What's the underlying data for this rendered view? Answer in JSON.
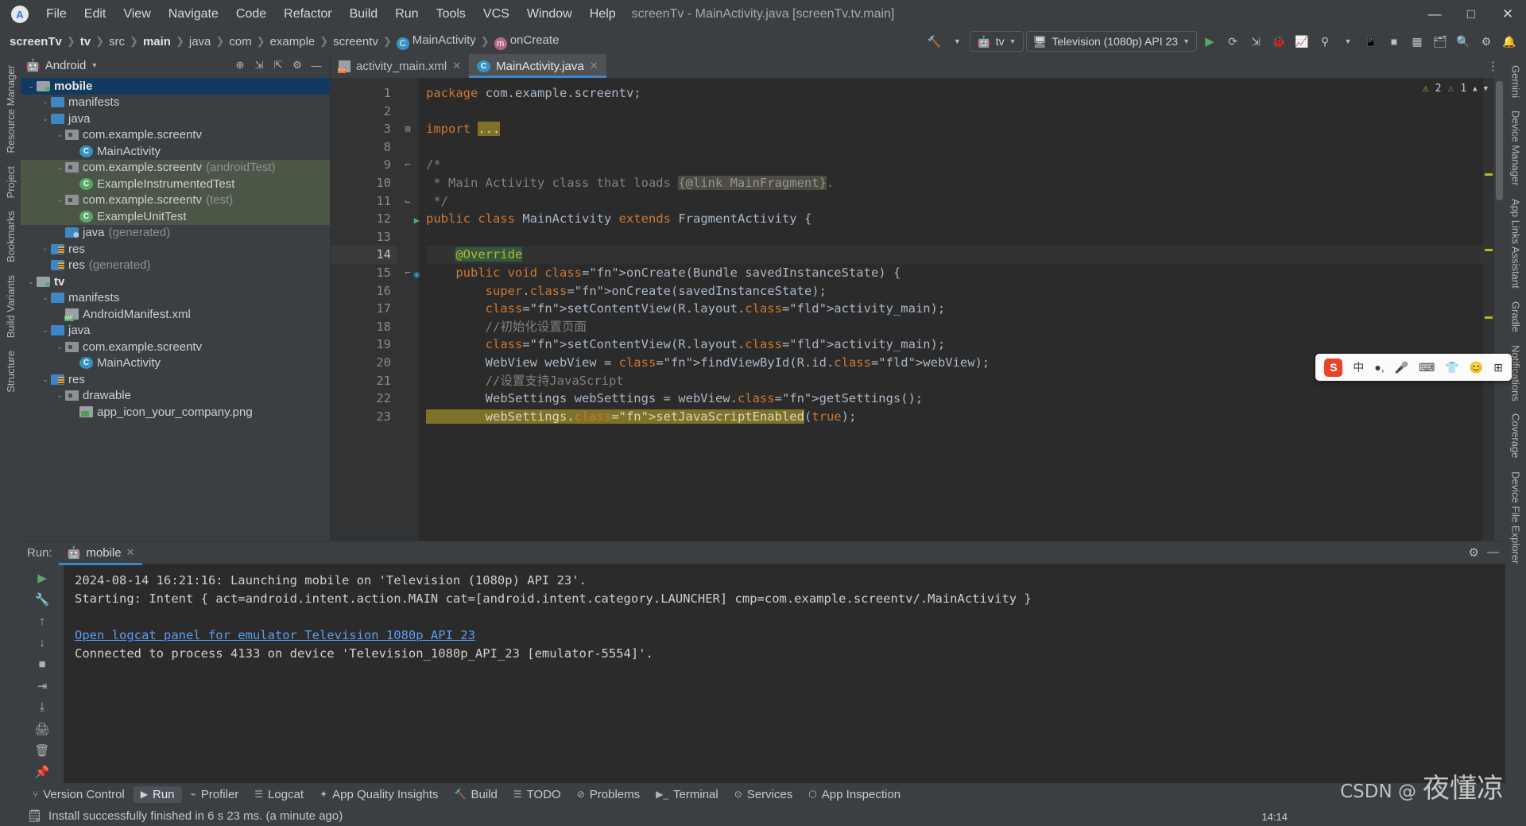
{
  "window": {
    "title": "screenTv - MainActivity.java [screenTv.tv.main]",
    "minimize": "—",
    "maximize": "□",
    "close": "✕"
  },
  "menu": [
    "File",
    "Edit",
    "View",
    "Navigate",
    "Code",
    "Refactor",
    "Build",
    "Run",
    "Tools",
    "VCS",
    "Window",
    "Help"
  ],
  "breadcrumbs": [
    {
      "label": "screenTv",
      "bold": true
    },
    {
      "label": "tv",
      "bold": true
    },
    {
      "label": "src",
      "bold": false
    },
    {
      "label": "main",
      "bold": true
    },
    {
      "label": "java",
      "bold": false
    },
    {
      "label": "com",
      "bold": false
    },
    {
      "label": "example",
      "bold": false
    },
    {
      "label": "screentv",
      "bold": false
    },
    {
      "label": "MainActivity",
      "bold": false,
      "icon": "class-icon"
    },
    {
      "label": "onCreate",
      "bold": false,
      "icon": "method-icon"
    }
  ],
  "toolbar": {
    "run_config": "tv",
    "device": "Television (1080p) API 23",
    "run_label": "▶",
    "icons": [
      "make-project-icon",
      "run-icon",
      "rerun-icon",
      "apply-changes-icon",
      "debug-icon",
      "profile-icon",
      "attach-debugger-icon",
      "more-run-icon",
      "device-manager-icon",
      "stop-icon",
      "layout-inspector-icon",
      "device-explorer-icon",
      "search-icon",
      "settings-icon",
      "notifications-icon"
    ]
  },
  "project_panel": {
    "title": "Android",
    "actions": [
      "select-opened-file-icon",
      "expand-all-icon",
      "collapse-all-icon",
      "settings-icon",
      "hide-icon"
    ],
    "tree": [
      {
        "depth": 0,
        "label": "mobile",
        "icon": "module-folder",
        "twisty": "v",
        "bold": true,
        "state": "selected"
      },
      {
        "depth": 1,
        "label": "manifests",
        "icon": "folder",
        "twisty": ">"
      },
      {
        "depth": 1,
        "label": "java",
        "icon": "folder",
        "twisty": "v"
      },
      {
        "depth": 2,
        "label": "com.example.screentv",
        "icon": "package",
        "twisty": "v"
      },
      {
        "depth": 3,
        "label": "MainActivity",
        "icon": "class"
      },
      {
        "depth": 2,
        "label": "com.example.screentv",
        "suffix": "(androidTest)",
        "icon": "package",
        "twisty": "v",
        "state": "test"
      },
      {
        "depth": 3,
        "label": "ExampleInstrumentedTest",
        "icon": "class-test",
        "state": "test"
      },
      {
        "depth": 2,
        "label": "com.example.screentv",
        "suffix": "(test)",
        "icon": "package",
        "twisty": "v",
        "state": "test"
      },
      {
        "depth": 3,
        "label": "ExampleUnitTest",
        "icon": "class-test",
        "state": "test"
      },
      {
        "depth": 2,
        "label": "java",
        "suffix": "(generated)",
        "icon": "folder-generated"
      },
      {
        "depth": 1,
        "label": "res",
        "icon": "folder-res",
        "twisty": ">"
      },
      {
        "depth": 1,
        "label": "res",
        "suffix": "(generated)",
        "icon": "folder-res"
      },
      {
        "depth": 0,
        "label": "tv",
        "icon": "module-folder",
        "twisty": "v",
        "bold": true
      },
      {
        "depth": 1,
        "label": "manifests",
        "icon": "folder",
        "twisty": "v"
      },
      {
        "depth": 2,
        "label": "AndroidManifest.xml",
        "icon": "manifest"
      },
      {
        "depth": 1,
        "label": "java",
        "icon": "folder",
        "twisty": "v"
      },
      {
        "depth": 2,
        "label": "com.example.screentv",
        "icon": "package",
        "twisty": "v"
      },
      {
        "depth": 3,
        "label": "MainActivity",
        "icon": "class"
      },
      {
        "depth": 1,
        "label": "res",
        "icon": "folder-res",
        "twisty": "v"
      },
      {
        "depth": 2,
        "label": "drawable",
        "icon": "package",
        "twisty": "v"
      },
      {
        "depth": 3,
        "label": "app_icon_your_company.png",
        "icon": "png"
      }
    ]
  },
  "editor": {
    "tabs": [
      {
        "label": "activity_main.xml",
        "icon": "xml-file-icon",
        "active": false,
        "close": "✕"
      },
      {
        "label": "MainActivity.java",
        "icon": "java-class-icon",
        "active": true,
        "close": "✕"
      }
    ],
    "inspections": {
      "warnings": "2",
      "weak_warnings": "1",
      "warn_icon": "⚠",
      "weak_icon": "⚠"
    },
    "lines": [
      {
        "n": "1",
        "code": "package com.example.screentv;"
      },
      {
        "n": "2",
        "code": ""
      },
      {
        "n": "3",
        "code": "import ...",
        "fold": "+"
      },
      {
        "n": "8",
        "code": ""
      },
      {
        "n": "9",
        "code": "/*",
        "fold": "v"
      },
      {
        "n": "10",
        "code": " * Main Activity class that loads {@link MainFragment}."
      },
      {
        "n": "11",
        "code": " */",
        "fold": "^"
      },
      {
        "n": "12",
        "code": "public class MainActivity extends FragmentActivity {",
        "gutter": "run-marker"
      },
      {
        "n": "13",
        "code": ""
      },
      {
        "n": "14",
        "code": "    @Override",
        "current": true
      },
      {
        "n": "15",
        "code": "    public void onCreate(Bundle savedInstanceState) {",
        "gutter": "override-marker",
        "fold": "v"
      },
      {
        "n": "16",
        "code": "        super.onCreate(savedInstanceState);"
      },
      {
        "n": "17",
        "code": "        setContentView(R.layout.activity_main);"
      },
      {
        "n": "18",
        "code": "        //初始化设置页面"
      },
      {
        "n": "19",
        "code": "        setContentView(R.layout.activity_main);"
      },
      {
        "n": "20",
        "code": "        WebView webView = findViewById(R.id.webView);"
      },
      {
        "n": "21",
        "code": "        //设置支持JavaScript"
      },
      {
        "n": "22",
        "code": "        WebSettings webSettings = webView.getSettings();"
      },
      {
        "n": "23",
        "code": "        webSettings.setJavaScriptEnabled(true);"
      }
    ]
  },
  "run_panel": {
    "label": "Run:",
    "tab": "mobile",
    "tab_close": "✕",
    "settings_icon": "gear-icon",
    "hide_icon": "—",
    "tool_icons": [
      "rerun-icon",
      "wrench-icon",
      "up-icon",
      "down-icon",
      "filter-icon",
      "stop-icon",
      "scroll-end-icon",
      "print-icon",
      "trash-icon",
      "pin-icon"
    ],
    "console": [
      {
        "text": "2024-08-14 16:21:16: Launching mobile on 'Television (1080p) API 23'.",
        "link": false
      },
      {
        "text": "Starting: Intent { act=android.intent.action.MAIN cat=[android.intent.category.LAUNCHER] cmp=com.example.screentv/.MainActivity }",
        "link": false
      },
      {
        "text": "",
        "link": false
      },
      {
        "text": "Open logcat panel for emulator Television 1080p API 23",
        "link": true
      },
      {
        "text": "Connected to process 4133 on device 'Television_1080p_API_23 [emulator-5554]'.",
        "link": false
      }
    ]
  },
  "bottom_tabs": [
    {
      "label": "Version Control",
      "icon": "branch-icon",
      "active": false
    },
    {
      "label": "Run",
      "icon": "run-icon",
      "active": true
    },
    {
      "label": "Profiler",
      "icon": "profiler-icon",
      "active": false
    },
    {
      "label": "Logcat",
      "icon": "logcat-icon",
      "active": false
    },
    {
      "label": "App Quality Insights",
      "icon": "insights-icon",
      "active": false
    },
    {
      "label": "Build",
      "icon": "build-icon",
      "active": false
    },
    {
      "label": "TODO",
      "icon": "todo-icon",
      "active": false
    },
    {
      "label": "Problems",
      "icon": "problems-icon",
      "active": false
    },
    {
      "label": "Terminal",
      "icon": "terminal-icon",
      "active": false
    },
    {
      "label": "Services",
      "icon": "services-icon",
      "active": false
    },
    {
      "label": "App Inspection",
      "icon": "app-inspection-icon",
      "active": false
    }
  ],
  "status_bar": {
    "icon": "event-log-icon",
    "message": "Install successfully finished in 6 s 23 ms. (a minute ago)"
  },
  "left_rail": [
    "Resource Manager",
    "Project",
    "Bookmarks",
    "Build Variants",
    "Structure"
  ],
  "right_rail": [
    "Gemini",
    "Device Manager",
    "App Links Assistant",
    "Gradle",
    "Notifications",
    "Coverage",
    "Device File Explorer"
  ],
  "ime": {
    "logo": "S",
    "items": [
      "中",
      "●,",
      "🎤",
      "⌨",
      "👕",
      "😊",
      "⊞"
    ]
  },
  "watermark": {
    "csdn": "CSDN @",
    "name": "夜懂凉"
  },
  "tray_clock": "14:14"
}
